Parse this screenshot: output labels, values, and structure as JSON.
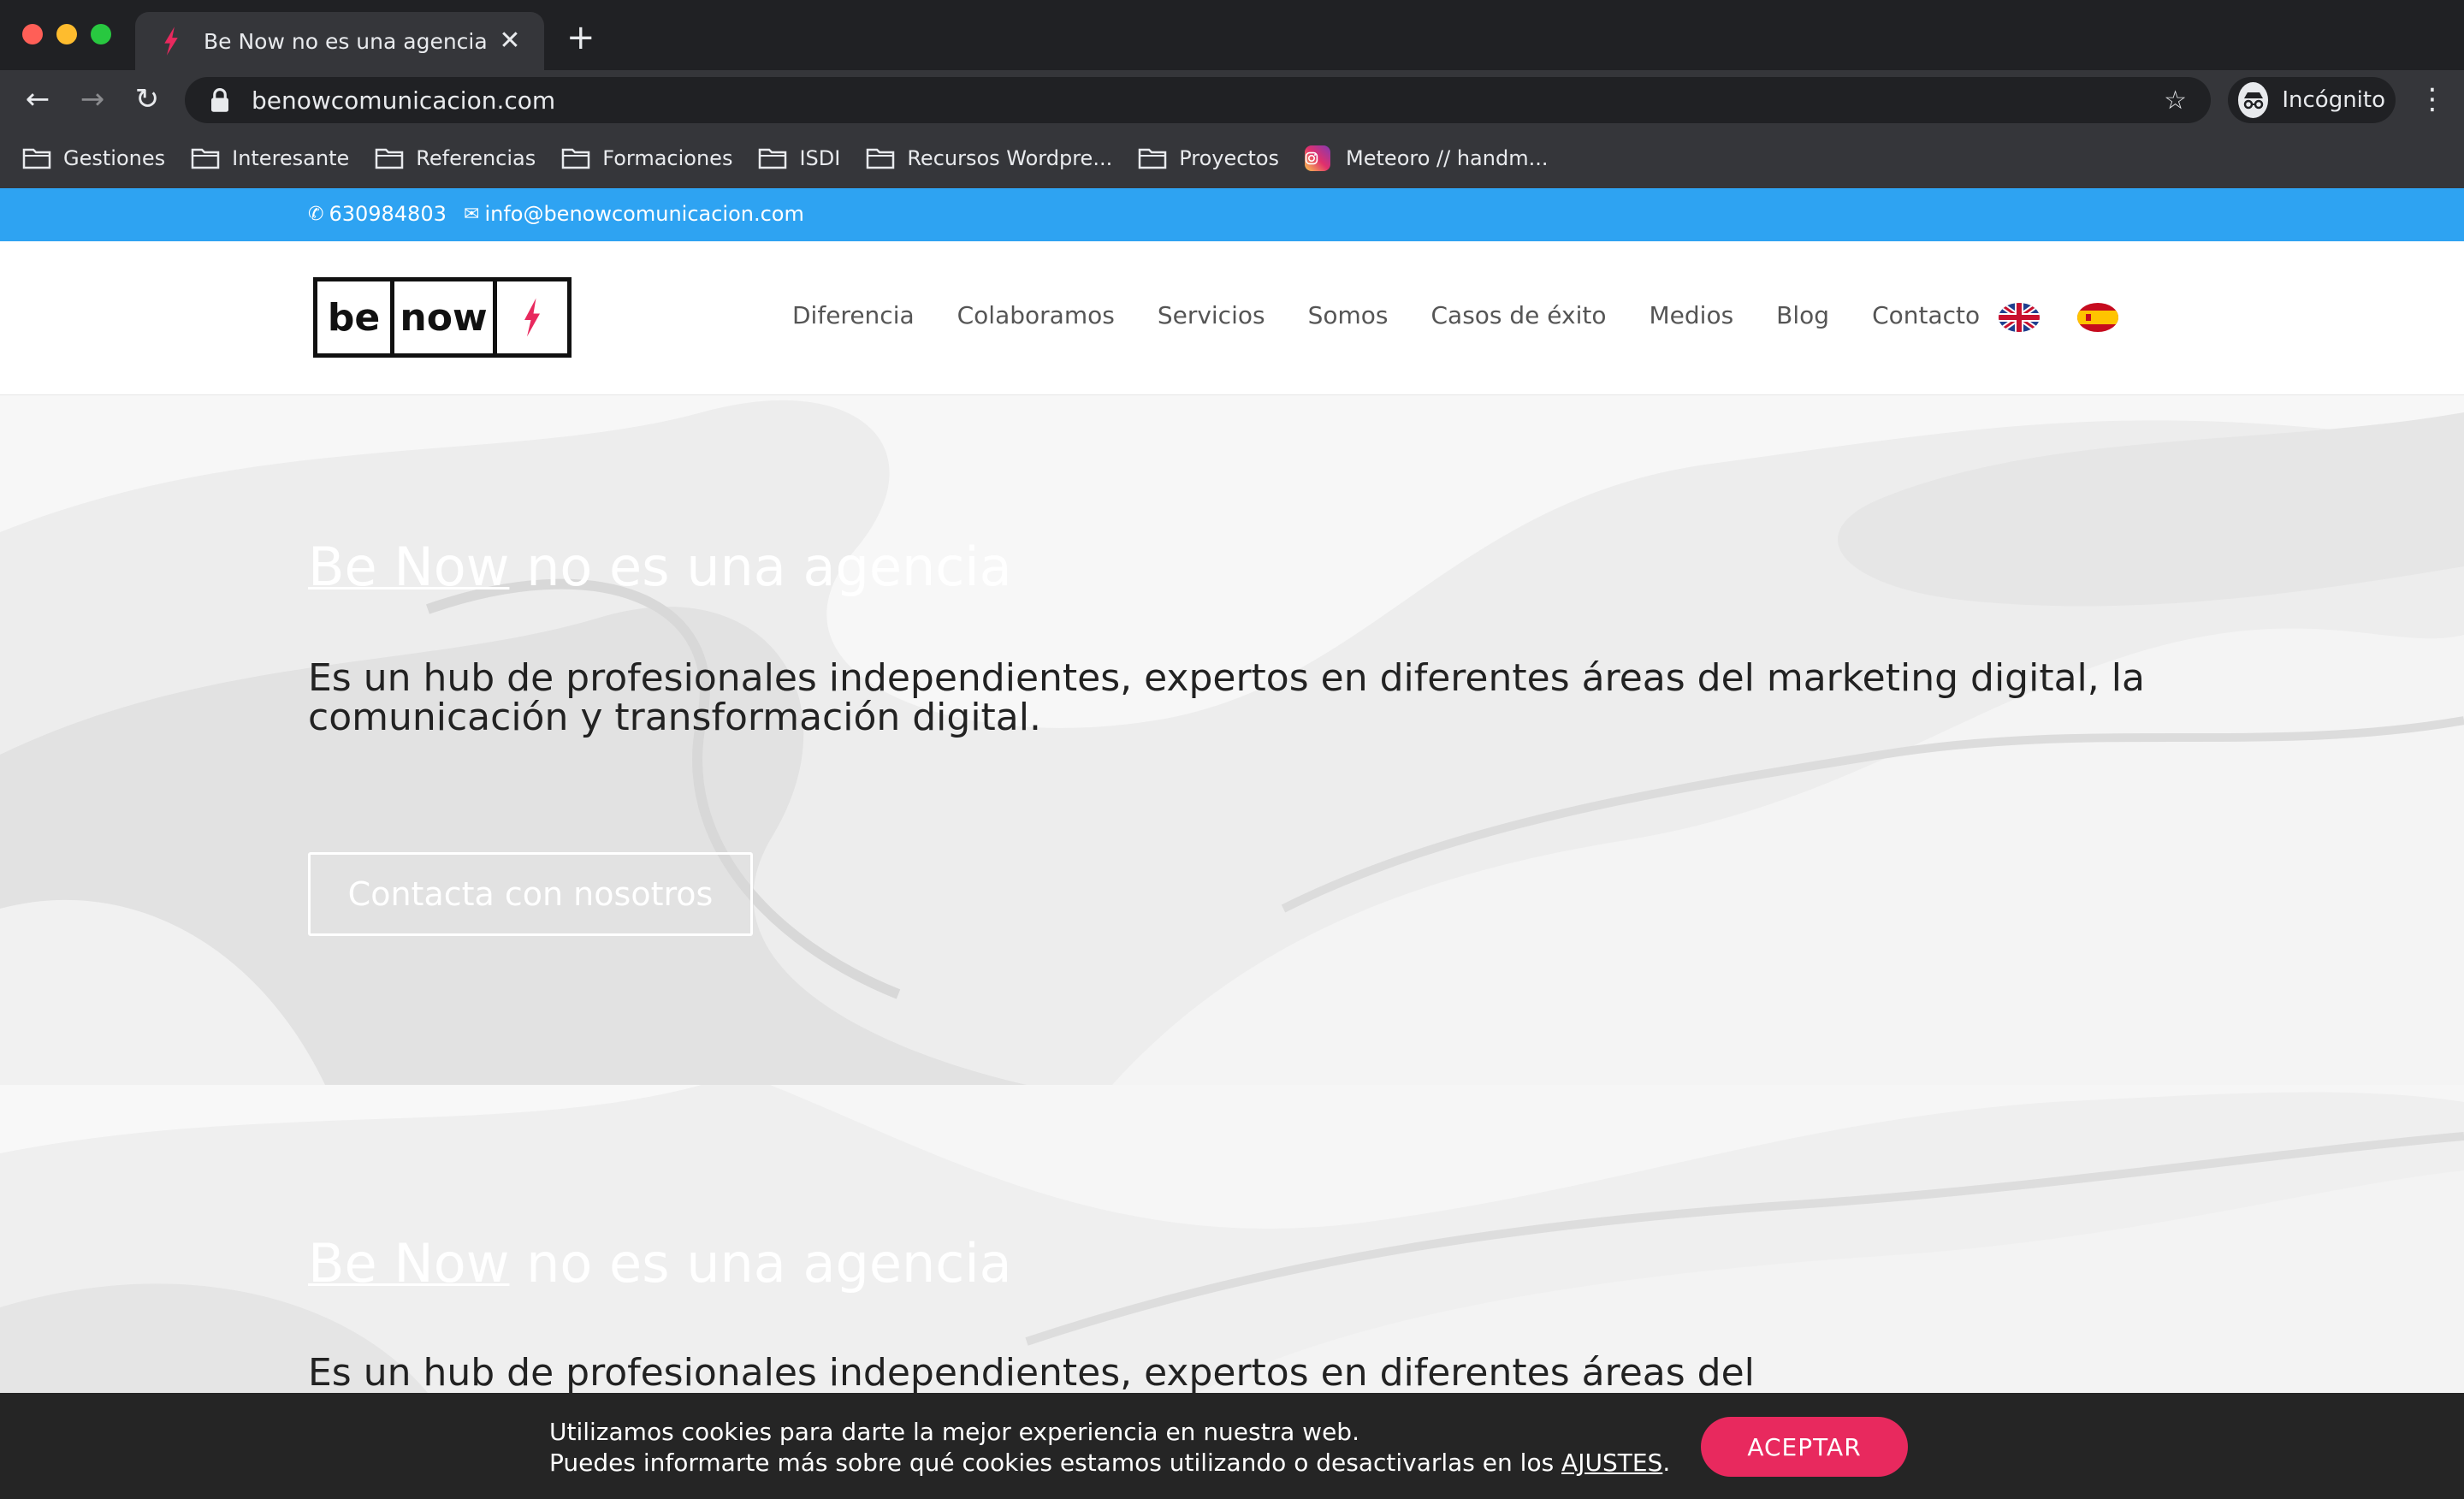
{
  "browser": {
    "tab_title": "Be Now no es una agencia",
    "url": "benowcomunicacion.com",
    "profile_label": "Incógnito",
    "bookmarks": [
      {
        "label": "Gestiones",
        "icon": "folder-icon"
      },
      {
        "label": "Interesante",
        "icon": "folder-icon"
      },
      {
        "label": "Referencias",
        "icon": "folder-icon"
      },
      {
        "label": "Formaciones",
        "icon": "folder-icon"
      },
      {
        "label": "ISDI",
        "icon": "folder-icon"
      },
      {
        "label": "Recursos Wordpre...",
        "icon": "folder-icon"
      },
      {
        "label": "Proyectos",
        "icon": "folder-icon"
      },
      {
        "label": "Meteoro // handm...",
        "icon": "instagram-icon"
      }
    ]
  },
  "topbar": {
    "phone": "630984803",
    "email": "info@benowcomunicacion.com"
  },
  "logo": {
    "word1": "be",
    "word2": "now"
  },
  "nav": {
    "items": [
      "Diferencia",
      "Colaboramos",
      "Servicios",
      "Somos",
      "Casos de éxito",
      "Medios",
      "Blog",
      "Contacto"
    ]
  },
  "hero": {
    "title_brand": "Be Now",
    "title_rest": " no es una agencia",
    "text": "Es un hub de profesionales independientes, expertos en diferentes áreas del marketing digital, la comunicación y transformación digital.",
    "cta": "Contacta con nosotros"
  },
  "hero2": {
    "title_brand": "Be Now",
    "title_rest": " no es una agencia",
    "text": "Es un hub de profesionales independientes, expertos en diferentes áreas del"
  },
  "cookie": {
    "line1": "Utilizamos cookies para darte la mejor experiencia en nuestra web.",
    "line2_pre": "Puedes informarte más sobre qué cookies estamos utilizando o desactivarlas en los ",
    "line2_link": "AJUSTES",
    "line2_post": ".",
    "accept": "ACEPTAR"
  },
  "colors": {
    "topbar": "#2ea3f2",
    "accent_pink": "#e8295e",
    "chrome_dark": "#202124",
    "chrome_toolbar": "#35363a"
  }
}
